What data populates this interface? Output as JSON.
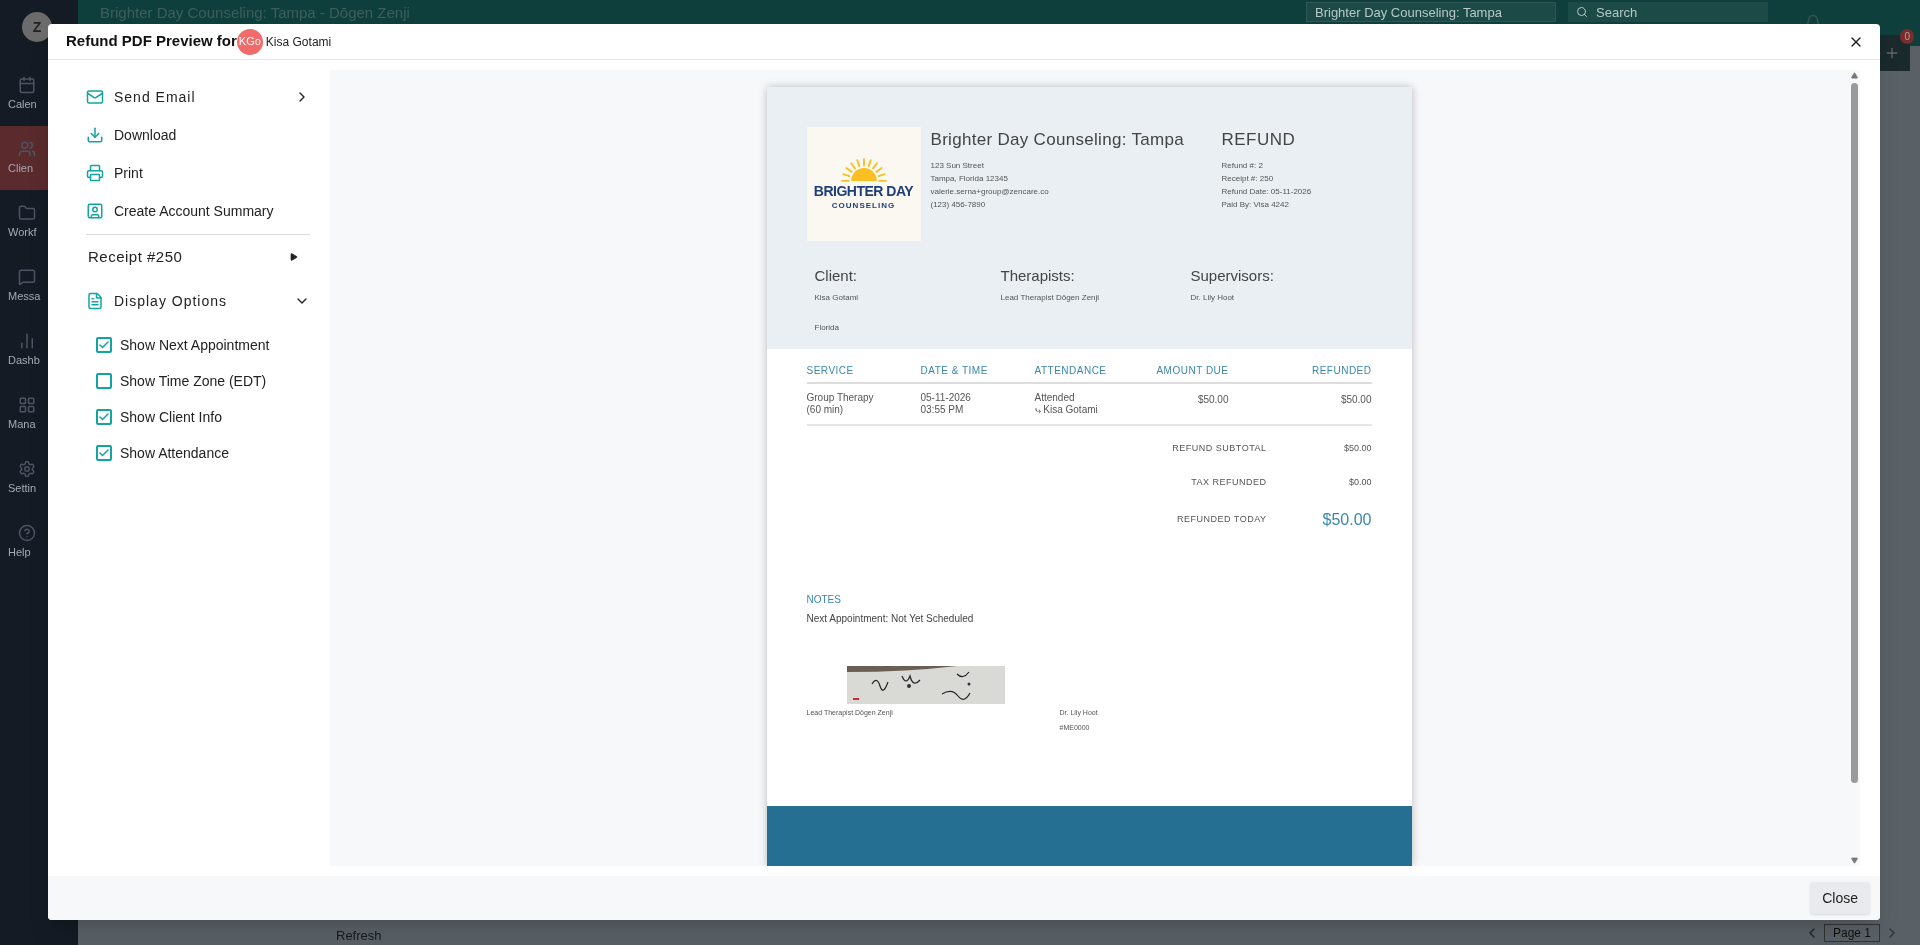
{
  "app": {
    "title": "Brighter Day Counseling: Tampa - Dōgen Zenji",
    "logo": "Z",
    "sidebar": [
      {
        "label": "Calen",
        "kind": "calendar",
        "selected": false
      },
      {
        "label": "Clien",
        "kind": "clients",
        "selected": true
      },
      {
        "label": "Workf",
        "kind": "folder",
        "selected": false
      },
      {
        "label": "Messa",
        "kind": "message",
        "selected": false
      },
      {
        "label": "Dashb",
        "kind": "chart",
        "selected": false
      },
      {
        "label": "Mana",
        "kind": "grid",
        "selected": false
      },
      {
        "label": "Settin",
        "kind": "gear",
        "selected": false
      },
      {
        "label": "Help",
        "kind": "help",
        "selected": false
      }
    ],
    "location_select": "Brighter Day Counseling: Tampa",
    "search_placeholder": "Search",
    "badge": "0",
    "refresh": "Refresh",
    "pager": "Page 1"
  },
  "modal": {
    "title": "Refund PDF Preview for",
    "avatar": "KGo",
    "client": "Kisa Gotami",
    "actions": [
      {
        "kind": "email",
        "label": "Send Email"
      },
      {
        "kind": "download",
        "label": "Download"
      },
      {
        "kind": "print",
        "label": "Print"
      },
      {
        "kind": "account",
        "label": "Create Account Summary"
      }
    ],
    "receipt": "Receipt #250",
    "display_options": {
      "label": "Display Options",
      "expanded": true,
      "options": [
        {
          "label": "Show Next Appointment",
          "checked": true
        },
        {
          "label": "Show Time Zone (EDT)",
          "checked": false
        },
        {
          "label": "Show Client Info",
          "checked": true
        },
        {
          "label": "Show Attendance",
          "checked": true
        }
      ]
    },
    "close_button": "Close"
  },
  "document": {
    "logo_top": "BRIGHTER DAY",
    "logo_bottom": "COUNSELING",
    "company": "Brighter Day Counseling: Tampa",
    "address": [
      "123 Sun Street",
      "Tampa, Florida 12345",
      "valerie.serna+group@zencare.co",
      "(123) 456-7890"
    ],
    "doc_type": "REFUND",
    "meta": [
      "Refund #: 2",
      "Receipt #: 250",
      "Refund Date: 05-11-2026",
      "Paid By: Visa 4242"
    ],
    "parties": [
      {
        "heading": "Client:",
        "lines": [
          "Kisa Gotami",
          "Florida"
        ]
      },
      {
        "heading": "Therapists:",
        "lines": [
          "Lead Therapist Dōgen Zenji"
        ]
      },
      {
        "heading": "Supervisors:",
        "lines": [
          "Dr. Lily Hoot"
        ]
      }
    ],
    "table": {
      "columns": [
        "SERVICE",
        "DATE & TIME",
        "ATTENDANCE",
        "AMOUNT DUE",
        "REFUNDED"
      ],
      "rows": [
        {
          "service": [
            "Group Therapy",
            "(60 min)"
          ],
          "datetime": [
            "05-11-2026",
            "03:55 PM"
          ],
          "attendance": [
            "Attended",
            "⤷ Kisa Gotami"
          ],
          "amount_due": "$50.00",
          "refunded": "$50.00"
        }
      ]
    },
    "totals": [
      {
        "label": "REFUND SUBTOTAL",
        "value": "$50.00",
        "kind": "normal"
      },
      {
        "label": "TAX REFUNDED",
        "value": "$0.00",
        "kind": "normal"
      },
      {
        "label": "REFUNDED TODAY",
        "value": "$50.00",
        "kind": "grand"
      }
    ],
    "notes_heading": "NOTES",
    "notes": "Next Appointment: Not Yet Scheduled",
    "signatures": [
      {
        "lines": [
          "Lead Therapist Dōgen Zenji"
        ],
        "has_image": true
      },
      {
        "lines": [
          "Dr. Lily Hoot",
          "#ME0000"
        ],
        "has_image": false
      }
    ]
  }
}
